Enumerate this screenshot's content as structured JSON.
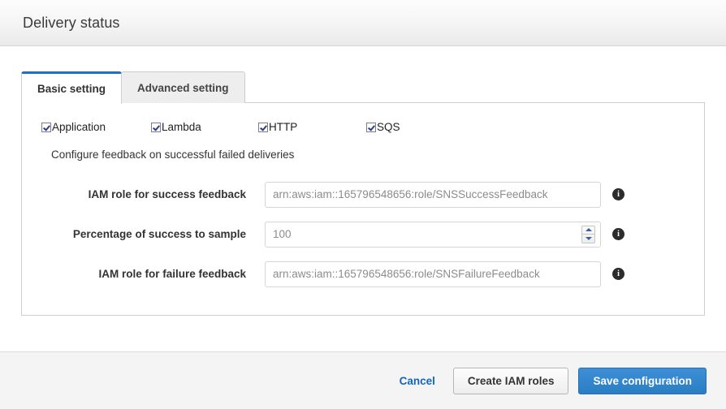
{
  "header": {
    "title": "Delivery status"
  },
  "tabs": [
    {
      "label": "Basic setting",
      "active": true
    },
    {
      "label": "Advanced setting",
      "active": false
    }
  ],
  "protocols": [
    {
      "label": "Application",
      "checked": true
    },
    {
      "label": "Lambda",
      "checked": true
    },
    {
      "label": "HTTP",
      "checked": true
    },
    {
      "label": "SQS",
      "checked": true
    }
  ],
  "section_note": "Configure feedback on successful failed deliveries",
  "fields": [
    {
      "label": "IAM role for success feedback",
      "value": "arn:aws:iam::165796548656:role/SNSSuccessFeedback",
      "placeholder": "arn:aws:iam::165796548656:role/SNSSuccessFeedback",
      "has_spinner": false,
      "info": "i"
    },
    {
      "label": "Percentage of success to sample",
      "value": "100",
      "placeholder": "100",
      "has_spinner": true,
      "info": "i"
    },
    {
      "label": "IAM role for failure feedback",
      "value": "arn:aws:iam::165796548656:role/SNSFailureFeedback",
      "placeholder": "arn:aws:iam::165796548656:role/SNSFailureFeedback",
      "has_spinner": false,
      "info": "i"
    }
  ],
  "footer": {
    "cancel_label": "Cancel",
    "create_roles_label": "Create IAM roles",
    "save_label": "Save configuration"
  },
  "colors": {
    "accent_blue": "#2a7ec4",
    "link_blue": "#1166bb",
    "tab_active_border": "#1f6fc4",
    "header_bg": "#f4f4f4"
  }
}
